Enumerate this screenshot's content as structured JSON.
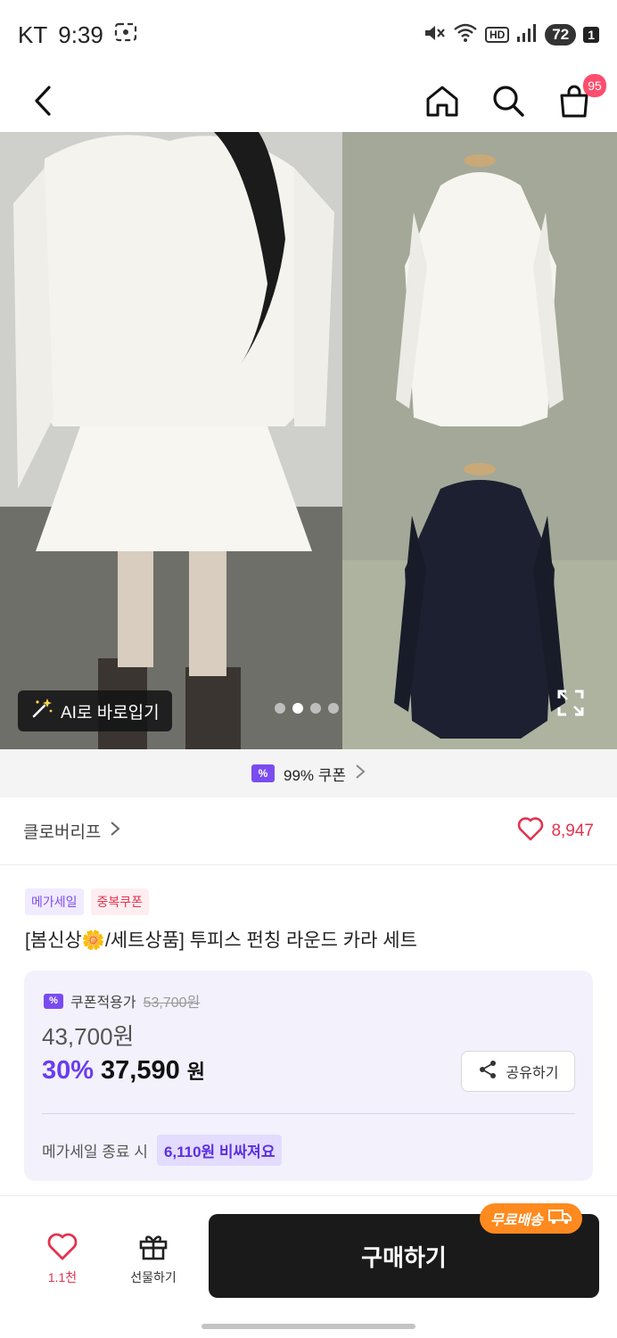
{
  "status_bar": {
    "carrier": "KT",
    "time": "9:39",
    "hd": "HD",
    "battery": "72",
    "sim": "1"
  },
  "nav": {
    "cart_count": "95"
  },
  "hero": {
    "ai_button_label": "AI로 바로입기",
    "slide_count": 4,
    "active_slide": 2
  },
  "coupon_strip": {
    "icon_text": "%",
    "label": "99% 쿠폰"
  },
  "brand": {
    "name": "클로버리프",
    "like_count": "8,947"
  },
  "tags": [
    "메가세일",
    "중복쿠폰"
  ],
  "product": {
    "title": "[봄신상🌼/세트상품] 투피스 펀칭 라운드 카라 세트"
  },
  "price": {
    "coupon_label": "쿠폰적용가",
    "original_price": "53,700원",
    "price": "43,700원",
    "discount_percent": "30%",
    "sale_price": "37,590",
    "won": "원",
    "share_label": "공유하기",
    "mega_sale_text": "메가세일 종료 시",
    "mega_sale_chip": "6,110원 비싸져요"
  },
  "bottom_bar": {
    "wish_count": "1.1천",
    "gift_label": "선물하기",
    "buy_label": "구매하기",
    "free_shipping_label": "무료배송"
  },
  "colors": {
    "accent_purple": "#6a3cf0",
    "like_red": "#e2344f",
    "shipping_orange": "#ff8a1f",
    "buy_black": "#1a1a1a"
  }
}
